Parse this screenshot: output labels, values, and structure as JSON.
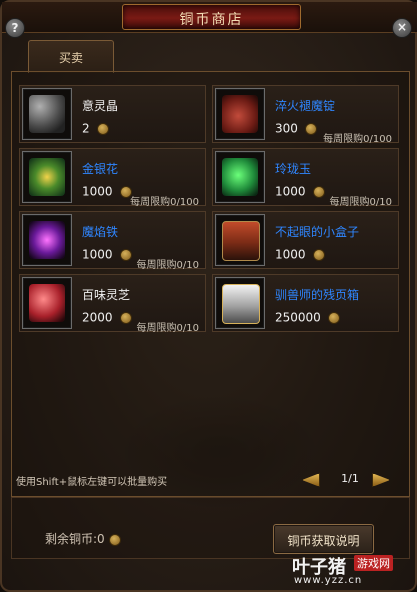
{
  "window": {
    "title": "铜币商店",
    "help_label": "?",
    "close_label": "×"
  },
  "tabs": [
    {
      "label": "买卖"
    }
  ],
  "items": [
    {
      "name": "意灵晶",
      "name_color": "#f0f0f0",
      "price": "2",
      "limit": "",
      "icon": "ore-crystal-icon"
    },
    {
      "name": "淬火褪魔锭",
      "name_color": "#2f86ff",
      "price": "300",
      "limit": "每周限购0/100",
      "icon": "bead-pouch-icon"
    },
    {
      "name": "金银花",
      "name_color": "#2f86ff",
      "price": "1000",
      "limit": "每周限购0/100",
      "icon": "flower-icon"
    },
    {
      "name": "玲珑玉",
      "name_color": "#2f86ff",
      "price": "1000",
      "limit": "每周限购0/10",
      "icon": "jade-icon"
    },
    {
      "name": "魔焰铁",
      "name_color": "#2f86ff",
      "price": "1000",
      "limit": "每周限购0/10",
      "icon": "purple-flame-icon"
    },
    {
      "name": "不起眼的小盒子",
      "name_color": "#2f86ff",
      "price": "1000",
      "limit": "",
      "icon": "chest-icon"
    },
    {
      "name": "百味灵芝",
      "name_color": "#f0f0f0",
      "price": "2000",
      "limit": "每周限购0/10",
      "icon": "mushroom-icon"
    },
    {
      "name": "驯兽师的残页箱",
      "name_color": "#2f86ff",
      "price": "250000",
      "limit": "",
      "icon": "silver-chest-icon"
    }
  ],
  "footer": {
    "hint": "使用Shift+鼠标左键可以批量购买",
    "page": "1/1",
    "remaining_label": "剩余铜币:",
    "remaining_value": "0",
    "explain_button": "铜币获取说明"
  },
  "watermark": {
    "brand": "叶子猪",
    "badge": "游戏网",
    "url": "www.yzz.cn"
  }
}
